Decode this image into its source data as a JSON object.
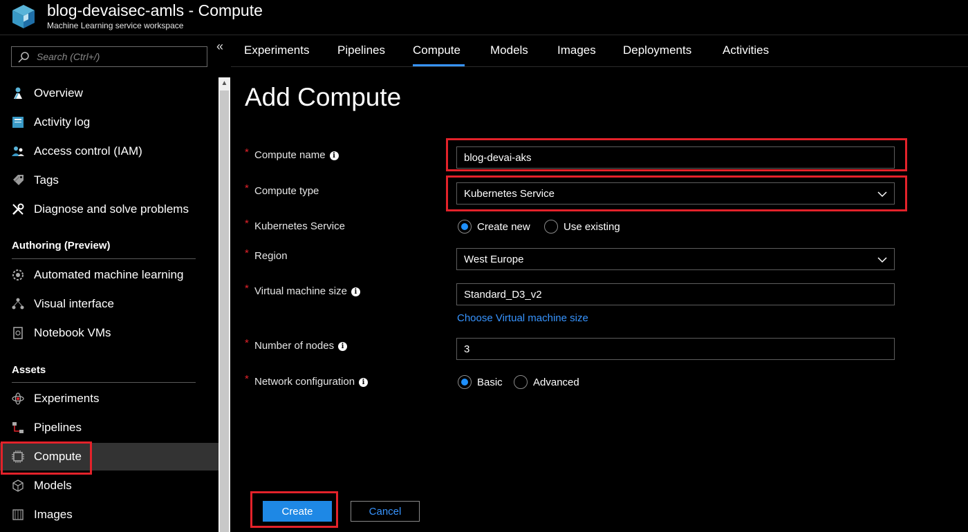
{
  "header": {
    "title": "blog-devaisec-amls - Compute",
    "subtitle": "Machine Learning service workspace",
    "logo_icon": "cube-icon"
  },
  "sidebar": {
    "search_placeholder": "Search (Ctrl+/)",
    "collapse_glyph": "«",
    "top_items": [
      {
        "label": "Overview",
        "icon": "overview-icon"
      },
      {
        "label": "Activity log",
        "icon": "activity-log-icon"
      },
      {
        "label": "Access control (IAM)",
        "icon": "iam-icon"
      },
      {
        "label": "Tags",
        "icon": "tag-icon"
      },
      {
        "label": "Diagnose and solve problems",
        "icon": "wrench-icon"
      }
    ],
    "authoring_title": "Authoring (Preview)",
    "authoring_items": [
      {
        "label": "Automated machine learning",
        "icon": "automl-icon"
      },
      {
        "label": "Visual interface",
        "icon": "visual-interface-icon"
      },
      {
        "label": "Notebook VMs",
        "icon": "notebook-icon"
      }
    ],
    "assets_title": "Assets",
    "assets_items": [
      {
        "label": "Experiments",
        "icon": "experiments-icon"
      },
      {
        "label": "Pipelines",
        "icon": "pipelines-icon"
      },
      {
        "label": "Compute",
        "icon": "compute-icon",
        "selected": true
      },
      {
        "label": "Models",
        "icon": "models-icon"
      },
      {
        "label": "Images",
        "icon": "images-icon"
      }
    ]
  },
  "tabs": [
    {
      "label": "Experiments"
    },
    {
      "label": "Pipelines"
    },
    {
      "label": "Compute",
      "active": true
    },
    {
      "label": "Models"
    },
    {
      "label": "Images"
    },
    {
      "label": "Deployments"
    },
    {
      "label": "Activities"
    }
  ],
  "form": {
    "title": "Add Compute",
    "required_mark": "*",
    "compute_name": {
      "label": "Compute name",
      "value": "blog-devai-aks"
    },
    "compute_type": {
      "label": "Compute type",
      "value": "Kubernetes Service"
    },
    "kubernetes_service": {
      "label": "Kubernetes Service",
      "options": [
        "Create new",
        "Use existing"
      ],
      "selected": "Create new"
    },
    "region": {
      "label": "Region",
      "value": "West Europe"
    },
    "vm_size": {
      "label": "Virtual machine size",
      "value": "Standard_D3_v2",
      "link": "Choose Virtual machine size"
    },
    "num_nodes": {
      "label": "Number of nodes",
      "value": "3"
    },
    "network_config": {
      "label": "Network configuration",
      "options": [
        "Basic",
        "Advanced"
      ],
      "selected": "Basic"
    },
    "info_glyph": "i"
  },
  "buttons": {
    "create": "Create",
    "cancel": "Cancel"
  },
  "colors": {
    "accent": "#3794ff",
    "highlight": "#e3222a",
    "primary_button": "#1e88e5"
  }
}
